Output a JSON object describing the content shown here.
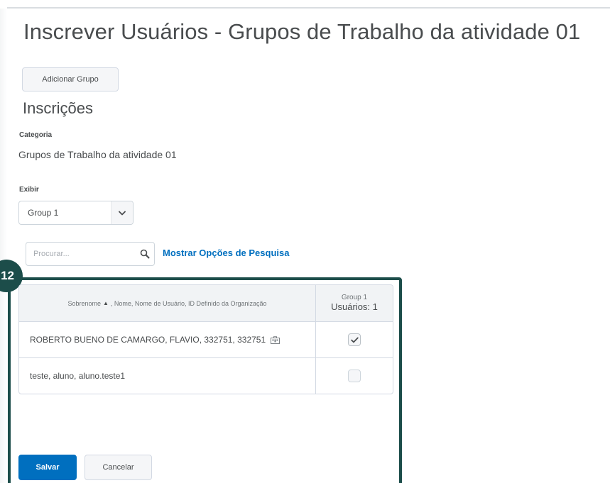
{
  "page": {
    "title": "Inscrever Usuários - Grupos de Trabalho da atividade 01",
    "add_group_label": "Adicionar Grupo",
    "section_title": "Inscrições"
  },
  "category": {
    "label": "Categoria",
    "value": "Grupos de Trabalho da atividade 01"
  },
  "view": {
    "label": "Exibir",
    "selected": "Group 1"
  },
  "search": {
    "placeholder": "Procurar...",
    "value": "",
    "options_link": "Mostrar Opções de Pesquisa",
    "icon": "search-icon"
  },
  "step_badge": "12",
  "table": {
    "header": {
      "sort_column": "Sobrenome",
      "other_columns": ", Nome, Nome de Usuário, ID Definido da Organização",
      "group_name": "Group 1",
      "group_count": "Usuários: 1"
    },
    "rows": [
      {
        "name": "ROBERTO BUENO DE CAMARGO, FLAVIO, 332751, 332751",
        "has_badge_icon": true,
        "checked": true
      },
      {
        "name": "teste, aluno, aluno.teste1",
        "has_badge_icon": false,
        "checked": false
      }
    ]
  },
  "actions": {
    "save_label": "Salvar",
    "cancel_label": "Cancelar"
  },
  "colors": {
    "primary": "#006fbf",
    "highlight": "#1c4d4a",
    "text": "#494c4e"
  }
}
